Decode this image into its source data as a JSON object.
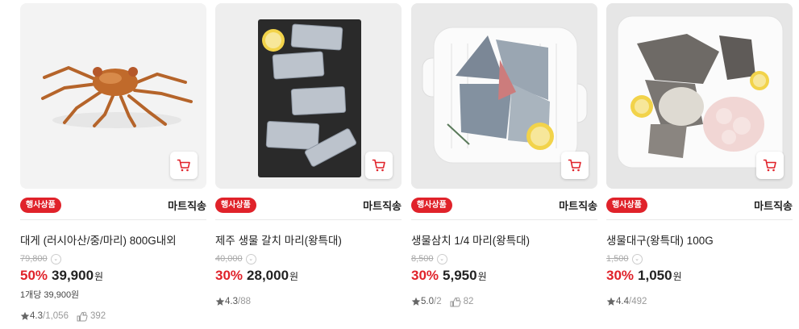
{
  "products": [
    {
      "name": "대게 (러시아산/중/마리) 800G내외",
      "badge": "행사상품",
      "delivery": "마트직송",
      "original_price": "79,800",
      "discount_rate": "50%",
      "price": "39,900",
      "currency": "원",
      "unit_price": "1개당 39,900원",
      "rating": "4.3",
      "review_count": "/1,056",
      "likes": "392",
      "image_icon": "snow-crab-image"
    },
    {
      "name": "제주 생물 갈치 마리(왕특대)",
      "badge": "행사상품",
      "delivery": "마트직송",
      "original_price": "40,000",
      "discount_rate": "30%",
      "price": "28,000",
      "currency": "원",
      "rating": "4.3",
      "review_count": "/88",
      "image_icon": "hairtail-fish-image"
    },
    {
      "name": "생물삼치 1/4 마리(왕특대)",
      "badge": "행사상품",
      "delivery": "마트직송",
      "original_price": "8,500",
      "discount_rate": "30%",
      "price": "5,950",
      "currency": "원",
      "rating": "5.0",
      "review_count": "/2",
      "likes": "82",
      "image_icon": "spanish-mackerel-image"
    },
    {
      "name": "생물대구(왕특대) 100G",
      "badge": "행사상품",
      "delivery": "마트직송",
      "original_price": "1,500",
      "discount_rate": "30%",
      "price": "1,050",
      "currency": "원",
      "rating": "4.4",
      "review_count": "/492",
      "image_icon": "cod-fish-image"
    }
  ],
  "colors": {
    "accent": "#e0222a",
    "card_bg": "#f2f2f2",
    "muted": "#aaaaaa"
  },
  "icons": {
    "cart": "cart-icon",
    "star": "star-icon",
    "like": "like-hand-icon",
    "info": "chevron-down-icon"
  }
}
